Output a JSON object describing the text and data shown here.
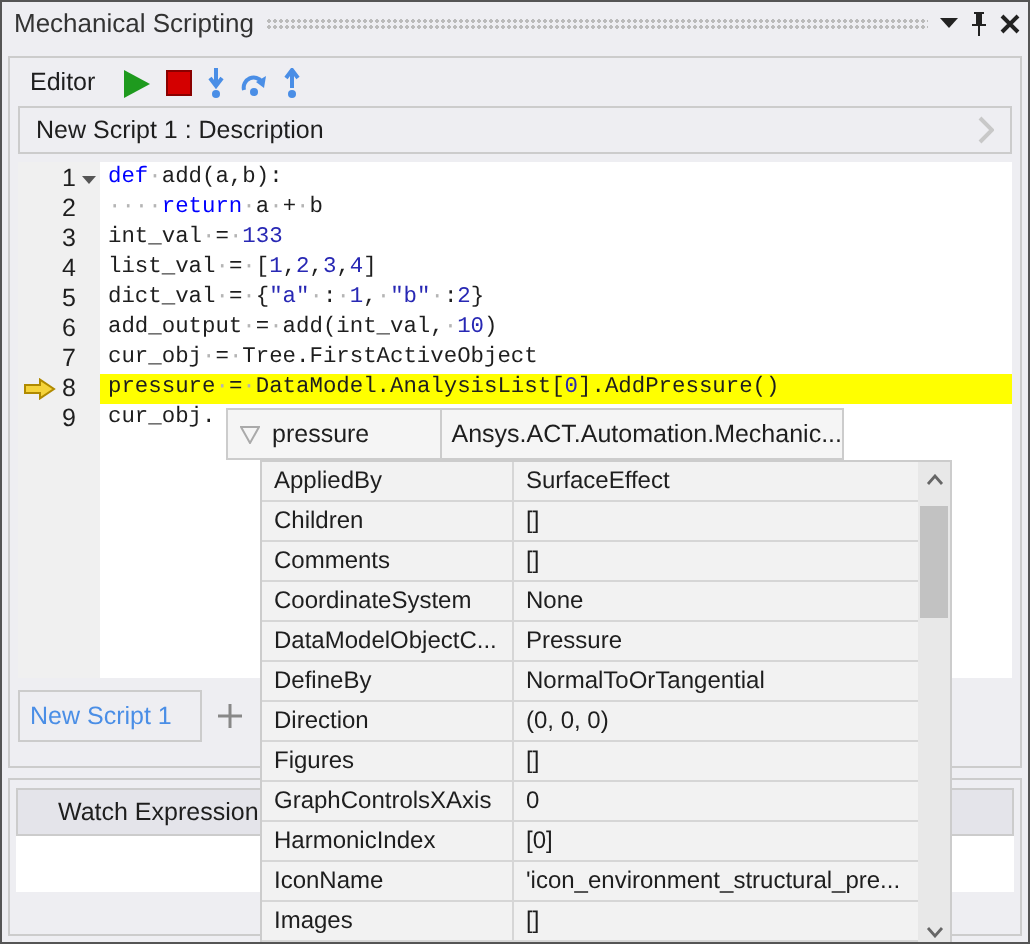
{
  "window": {
    "title": "Mechanical Scripting"
  },
  "editor": {
    "label": "Editor",
    "description": "New Script 1  : Description",
    "lines": [
      {
        "number": "1",
        "foldable": true,
        "current": false,
        "tokens": [
          {
            "kind": "kw",
            "text": "def"
          },
          {
            "kind": "ws",
            "text": "·"
          },
          {
            "kind": "plain",
            "text": "add(a,b):"
          }
        ]
      },
      {
        "number": "2",
        "foldable": false,
        "current": false,
        "tokens": [
          {
            "kind": "ws",
            "text": "····"
          },
          {
            "kind": "kw",
            "text": "return"
          },
          {
            "kind": "ws",
            "text": "·"
          },
          {
            "kind": "plain",
            "text": "a"
          },
          {
            "kind": "ws",
            "text": "·"
          },
          {
            "kind": "plain",
            "text": "+"
          },
          {
            "kind": "ws",
            "text": "·"
          },
          {
            "kind": "plain",
            "text": "b"
          }
        ]
      },
      {
        "number": "3",
        "foldable": false,
        "current": false,
        "tokens": [
          {
            "kind": "plain",
            "text": "int_val"
          },
          {
            "kind": "ws",
            "text": "·"
          },
          {
            "kind": "plain",
            "text": "="
          },
          {
            "kind": "ws",
            "text": "·"
          },
          {
            "kind": "num",
            "text": "133"
          }
        ]
      },
      {
        "number": "4",
        "foldable": false,
        "current": false,
        "tokens": [
          {
            "kind": "plain",
            "text": "list_val"
          },
          {
            "kind": "ws",
            "text": "·"
          },
          {
            "kind": "plain",
            "text": "="
          },
          {
            "kind": "ws",
            "text": "·"
          },
          {
            "kind": "plain",
            "text": "["
          },
          {
            "kind": "num",
            "text": "1"
          },
          {
            "kind": "plain",
            "text": ","
          },
          {
            "kind": "num",
            "text": "2"
          },
          {
            "kind": "plain",
            "text": ","
          },
          {
            "kind": "num",
            "text": "3"
          },
          {
            "kind": "plain",
            "text": ","
          },
          {
            "kind": "num",
            "text": "4"
          },
          {
            "kind": "plain",
            "text": "]"
          }
        ]
      },
      {
        "number": "5",
        "foldable": false,
        "current": false,
        "tokens": [
          {
            "kind": "plain",
            "text": "dict_val"
          },
          {
            "kind": "ws",
            "text": "·"
          },
          {
            "kind": "plain",
            "text": "="
          },
          {
            "kind": "ws",
            "text": "·"
          },
          {
            "kind": "plain",
            "text": "{"
          },
          {
            "kind": "str",
            "text": "\"a\""
          },
          {
            "kind": "ws",
            "text": "·"
          },
          {
            "kind": "plain",
            "text": ":"
          },
          {
            "kind": "ws",
            "text": "·"
          },
          {
            "kind": "num",
            "text": "1"
          },
          {
            "kind": "plain",
            "text": ","
          },
          {
            "kind": "ws",
            "text": "·"
          },
          {
            "kind": "str",
            "text": "\"b\""
          },
          {
            "kind": "ws",
            "text": "·"
          },
          {
            "kind": "plain",
            "text": ":"
          },
          {
            "kind": "num",
            "text": "2"
          },
          {
            "kind": "plain",
            "text": "}"
          }
        ]
      },
      {
        "number": "6",
        "foldable": false,
        "current": false,
        "tokens": [
          {
            "kind": "plain",
            "text": "add_output"
          },
          {
            "kind": "ws",
            "text": "·"
          },
          {
            "kind": "plain",
            "text": "="
          },
          {
            "kind": "ws",
            "text": "·"
          },
          {
            "kind": "plain",
            "text": "add(int_val,"
          },
          {
            "kind": "ws",
            "text": "·"
          },
          {
            "kind": "num",
            "text": "10"
          },
          {
            "kind": "plain",
            "text": ")"
          }
        ]
      },
      {
        "number": "7",
        "foldable": false,
        "current": false,
        "tokens": [
          {
            "kind": "plain",
            "text": "cur_obj"
          },
          {
            "kind": "ws",
            "text": "·"
          },
          {
            "kind": "plain",
            "text": "="
          },
          {
            "kind": "ws",
            "text": "·"
          },
          {
            "kind": "plain",
            "text": "Tree.FirstActiveObject"
          }
        ]
      },
      {
        "number": "8",
        "foldable": false,
        "current": true,
        "tokens": [
          {
            "kind": "plain",
            "text": "pressure"
          },
          {
            "kind": "ws",
            "text": "·"
          },
          {
            "kind": "plain",
            "text": "="
          },
          {
            "kind": "ws",
            "text": "·"
          },
          {
            "kind": "plain",
            "text": "DataModel.AnalysisList["
          },
          {
            "kind": "num",
            "text": "0"
          },
          {
            "kind": "plain",
            "text": "].AddPressure()"
          }
        ]
      },
      {
        "number": "9",
        "foldable": false,
        "current": false,
        "tokens": [
          {
            "kind": "plain",
            "text": "cur_obj."
          }
        ]
      }
    ]
  },
  "tabs": [
    {
      "label": "New Script 1",
      "selected": true
    }
  ],
  "watch": {
    "column": "Watch Expression"
  },
  "popup": {
    "name": "pressure",
    "type": "Ansys.ACT.Automation.Mechanic...",
    "rows": [
      {
        "property": "AppliedBy",
        "value": "SurfaceEffect"
      },
      {
        "property": "Children",
        "value": "[]"
      },
      {
        "property": "Comments",
        "value": "[]"
      },
      {
        "property": "CoordinateSystem",
        "value": "None"
      },
      {
        "property": "DataModelObjectC...",
        "value": "Pressure"
      },
      {
        "property": "DefineBy",
        "value": "NormalToOrTangential"
      },
      {
        "property": "Direction",
        "value": "(0, 0, 0)"
      },
      {
        "property": "Figures",
        "value": "[]"
      },
      {
        "property": "GraphControlsXAxis",
        "value": "0"
      },
      {
        "property": "HarmonicIndex",
        "value": "[0]"
      },
      {
        "property": "IconName",
        "value": "'icon_environment_structural_pre..."
      },
      {
        "property": "Images",
        "value": "[]"
      }
    ]
  }
}
